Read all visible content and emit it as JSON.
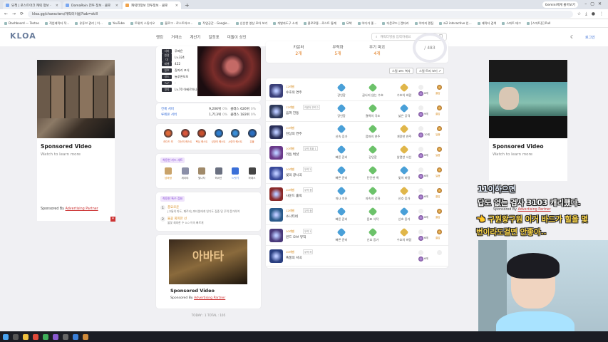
{
  "browser": {
    "tabs": [
      {
        "title": "묘책 | 로스트아크 캐릭 정보 ·"
      },
      {
        "title": "DomaRoin 전투 정보 · 클로"
      },
      {
        "title": "캐릭터정보 전투정보 · 클로"
      }
    ],
    "new_tab_icon": "plus-icon",
    "profile_chip": "Gemini에게 물어보기",
    "url": "kloa.gg/characters/캐릭터이름?tab=skill",
    "bookmarks": [
      "Dashboard — Testoo",
      "직업캐릭터 작...",
      "유튜브 관리 | 이...",
      "YouTube",
      "트위치 스튜디오",
      "블로그 - 로스트아크...",
      "작업공간 - Google...",
      "신선한 영상 모아 보기",
      "개발자도구 소개",
      "클로로좋…로스트 통계",
      "묘책",
      "어디가 좋…",
      "다운로드 | 렌더러",
      "이미지 편집",
      "ai2 interactive 인…",
      "캐릭터 검색",
      "스마트 태그",
      "[스마트폰] Pull"
    ]
  },
  "site": {
    "logo": "KLOA",
    "nav": [
      "랭킹",
      "거래소",
      "계산기",
      "일정표",
      "미돌이 상인"
    ],
    "search_placeholder": "캐릭터명을 입력하세요",
    "search_key": "/",
    "login": "로그인"
  },
  "profile": {
    "info_labels": [
      "서버",
      "원정대",
      "레벨",
      "칭호",
      "길드",
      "PvP",
      "영지"
    ],
    "info_values": [
      "루페온",
      "Lv.324",
      "422",
      "잠자리 포식",
      "늘푸른모모",
      "-",
      "Lv.70 아베르하나"
    ],
    "stats": [
      {
        "label": "전체 서버",
        "value": "9,206위",
        "pct": "0%",
        "class_label": "클래스 626위",
        "class_pct": "0%"
      },
      {
        "label": "루페온 서버",
        "value": "1,713위",
        "pct": "0%",
        "class_label": "클래스 183위",
        "class_pct": "0%"
      }
    ],
    "gems": [
      "레이드 퀵",
      "여신의 퀘스트",
      "핵심 퀘스트",
      "성장의 퀘스트",
      "시련의 퀘스트",
      "유물"
    ],
    "card_set_title": "착용한 카드 세트",
    "card_set": [
      "남바람",
      "세이야",
      "빛나자",
      "퀵셔선",
      "느릿기",
      "하데스"
    ],
    "points_title": "착용한 특수 점표",
    "points": [
      {
        "n": "1",
        "title": "풍요로운",
        "desc": "[고통의 마도, 페르티] 파티원에게 냉기도 집중 및 무력 증가하여"
      },
      {
        "n": "2",
        "title": "불꽃 회피한 선",
        "desc": "불꽃 회피한 수 0.0 이속 빠르게"
      }
    ],
    "footer": "TODAY : 1    TOTAL : 105"
  },
  "summary": {
    "columns": [
      "카운터",
      "무력화",
      "무기 파괴"
    ],
    "values": [
      "2개",
      "5개",
      "4개"
    ],
    "gauge": "/ 483"
  },
  "buttons": {
    "guide": "스킬 코드 복사",
    "tree": "스킬 트리 보기 ↗"
  },
  "skills": [
    {
      "tag": "12레벨",
      "name": "수호의 연주",
      "ex": "",
      "tripods": [
        "강인함",
        "끊나지 않는 수호",
        "수호의 바람"
      ],
      "gem1": "6레",
      "gem2": "쿨감"
    },
    {
      "tag": "12레벨",
      "name": "음파 진동",
      "ex": "카운터 무력 2",
      "tripods": [
        "강인함",
        "결벽의 곡조",
        "넓은 공격"
      ],
      "gem1": "9레",
      "gem2": "쿨감"
    },
    {
      "tag": "10레벨",
      "name": "천상의 연주",
      "ex": "",
      "tripods": [
        "신속 증가",
        "음파의 연주",
        "개량한 연주"
      ],
      "gem1": "10레",
      "gem2": "딜증"
    },
    {
      "tag": "10레벨",
      "name": "리듬 벅샷",
      "ex": "무력 피회 1",
      "tripods": [
        "빠른 준비",
        "강인함",
        "날렵한 사선"
      ],
      "gem1": "6레",
      "gem2": "딜증"
    },
    {
      "tag": "10레벨",
      "name": "빛의 광시곡",
      "ex": "무력 2",
      "tripods": [
        "빠른 준비",
        "단단한 벽",
        "빛의 바람"
      ],
      "gem1": "6레",
      "gem2": "딜증"
    },
    {
      "tag": "10레벨",
      "name": "사운드 홀릭",
      "ex": "무력 중",
      "tripods": [
        "마나 치유",
        "자속의 강화",
        "신호 증가"
      ],
      "gem1": "6레",
      "gem2": "쿨감"
    },
    {
      "tag": "12레벨",
      "name": "소나티네",
      "ex": "무력 중",
      "tripods": [
        "빠른 준비",
        "음표 식탁",
        "신호 증가"
      ],
      "gem1": "6레",
      "gem2": "쿨감"
    },
    {
      "tag": "10레벨",
      "name": "윈드 오브 뮤직",
      "ex": "무력 1",
      "tripods": [
        "빠른 준비",
        "신호 증가",
        "수호의 바람"
      ],
      "gem1": "6레",
      "gem2": "쿨감"
    },
    {
      "tag": "10레벨",
      "name": "폭풍의 서곡",
      "ex": "무력 하",
      "tripods": [],
      "gem1": "6레",
      "gem2": ""
    }
  ],
  "ads": {
    "left": {
      "title": "Sponsored Video",
      "subtitle": "Watch to learn more",
      "sponsor_prefix": "Sponsored By",
      "sponsor": "Advertising Partner"
    },
    "right": {
      "title": "Sponsored Video",
      "subtitle": "Watch to learn more",
      "sponsor_prefix": "Sponsored By",
      "sponsor": "Advertising Partner"
    },
    "center": {
      "title": "Sponsored Video",
      "sponsor_prefix": "Sponsored By",
      "sponsor": "Advertising Partner",
      "poster_text": "아바타"
    }
  },
  "stream": {
    "line1": "11이하으면",
    "line2": "답도 없는 검사 3103 캐리했다.",
    "line3": "👈 구원왕구원 이거 바드가 힐을 몇",
    "line4": "번이라도걸면 안좋아.."
  }
}
